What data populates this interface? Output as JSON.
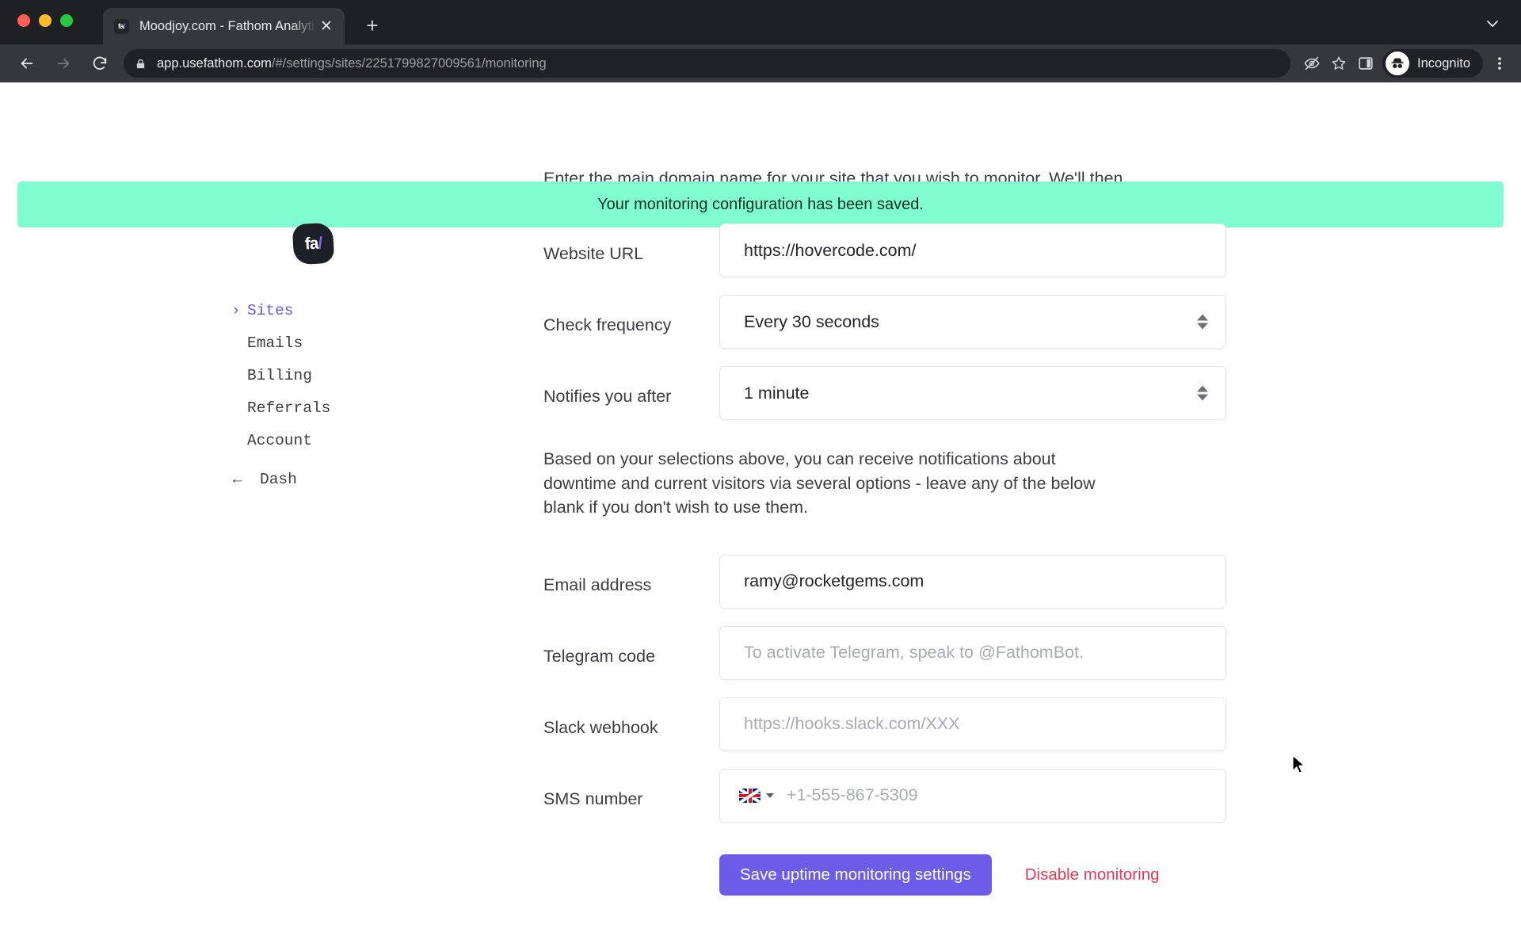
{
  "browser": {
    "tab": {
      "title": "Moodjoy.com - Fathom Analytics",
      "favicon_label": "fa/",
      "close_label": "✕"
    },
    "new_tab_label": "+",
    "toolbar": {
      "back_icon": "back-arrow-icon",
      "forward_icon": "forward-arrow-icon",
      "reload_icon": "reload-icon",
      "lock_icon": "lock-icon",
      "url_host": "app.usefathom.com",
      "url_path": "/#/settings/sites/2251799827009561/monitoring",
      "full_url": "app.usefathom.com/#/settings/sites/2251799827009561/monitoring",
      "eye_off_icon": "eye-off-icon",
      "bookmark_icon": "star-icon",
      "side_panel_icon": "side-panel-icon",
      "incognito_label": "Incognito",
      "menu_icon": "three-dot-menu-icon"
    }
  },
  "page": {
    "clipped_intro": "Enter the main domain name for your site that you wish to monitor. We'll then",
    "flash_message": "Your monitoring configuration has been saved.",
    "flash_color": "#7ffdd0",
    "accent_color": "#6c5ce7",
    "danger_color": "#e63757"
  },
  "sidebar": {
    "logo_text": "fa/",
    "items": [
      {
        "label": "Sites",
        "active": true,
        "prefix": "›"
      },
      {
        "label": "Emails",
        "active": false,
        "prefix": ""
      },
      {
        "label": "Billing",
        "active": false,
        "prefix": ""
      },
      {
        "label": "Referrals",
        "active": false,
        "prefix": ""
      },
      {
        "label": "Account",
        "active": false,
        "prefix": ""
      },
      {
        "label": "Dash",
        "active": false,
        "prefix": "←"
      }
    ]
  },
  "form": {
    "website_url": {
      "label": "Website URL",
      "value": "https://hovercode.com/"
    },
    "check_frequency": {
      "label": "Check frequency",
      "value": "Every 30 seconds"
    },
    "notifies_after": {
      "label": "Notifies you after",
      "value": "1 minute"
    },
    "description": "Based on your selections above, you can receive notifications about downtime and current visitors via several options - leave any of the below blank if you don't wish to use them.",
    "email_address": {
      "label": "Email address",
      "value": "ramy@rocketgems.com"
    },
    "telegram_code": {
      "label": "Telegram code",
      "value": "",
      "placeholder": "To activate Telegram, speak to @FathomBot."
    },
    "slack_webhook": {
      "label": "Slack webhook",
      "value": "",
      "placeholder": "https://hooks.slack.com/XXX"
    },
    "sms_number": {
      "label": "SMS number",
      "value": "",
      "placeholder": "+1-555-867-5309",
      "country_flag": "uk-flag-icon"
    },
    "save_button": "Save uptime monitoring settings",
    "disable_link": "Disable monitoring"
  }
}
